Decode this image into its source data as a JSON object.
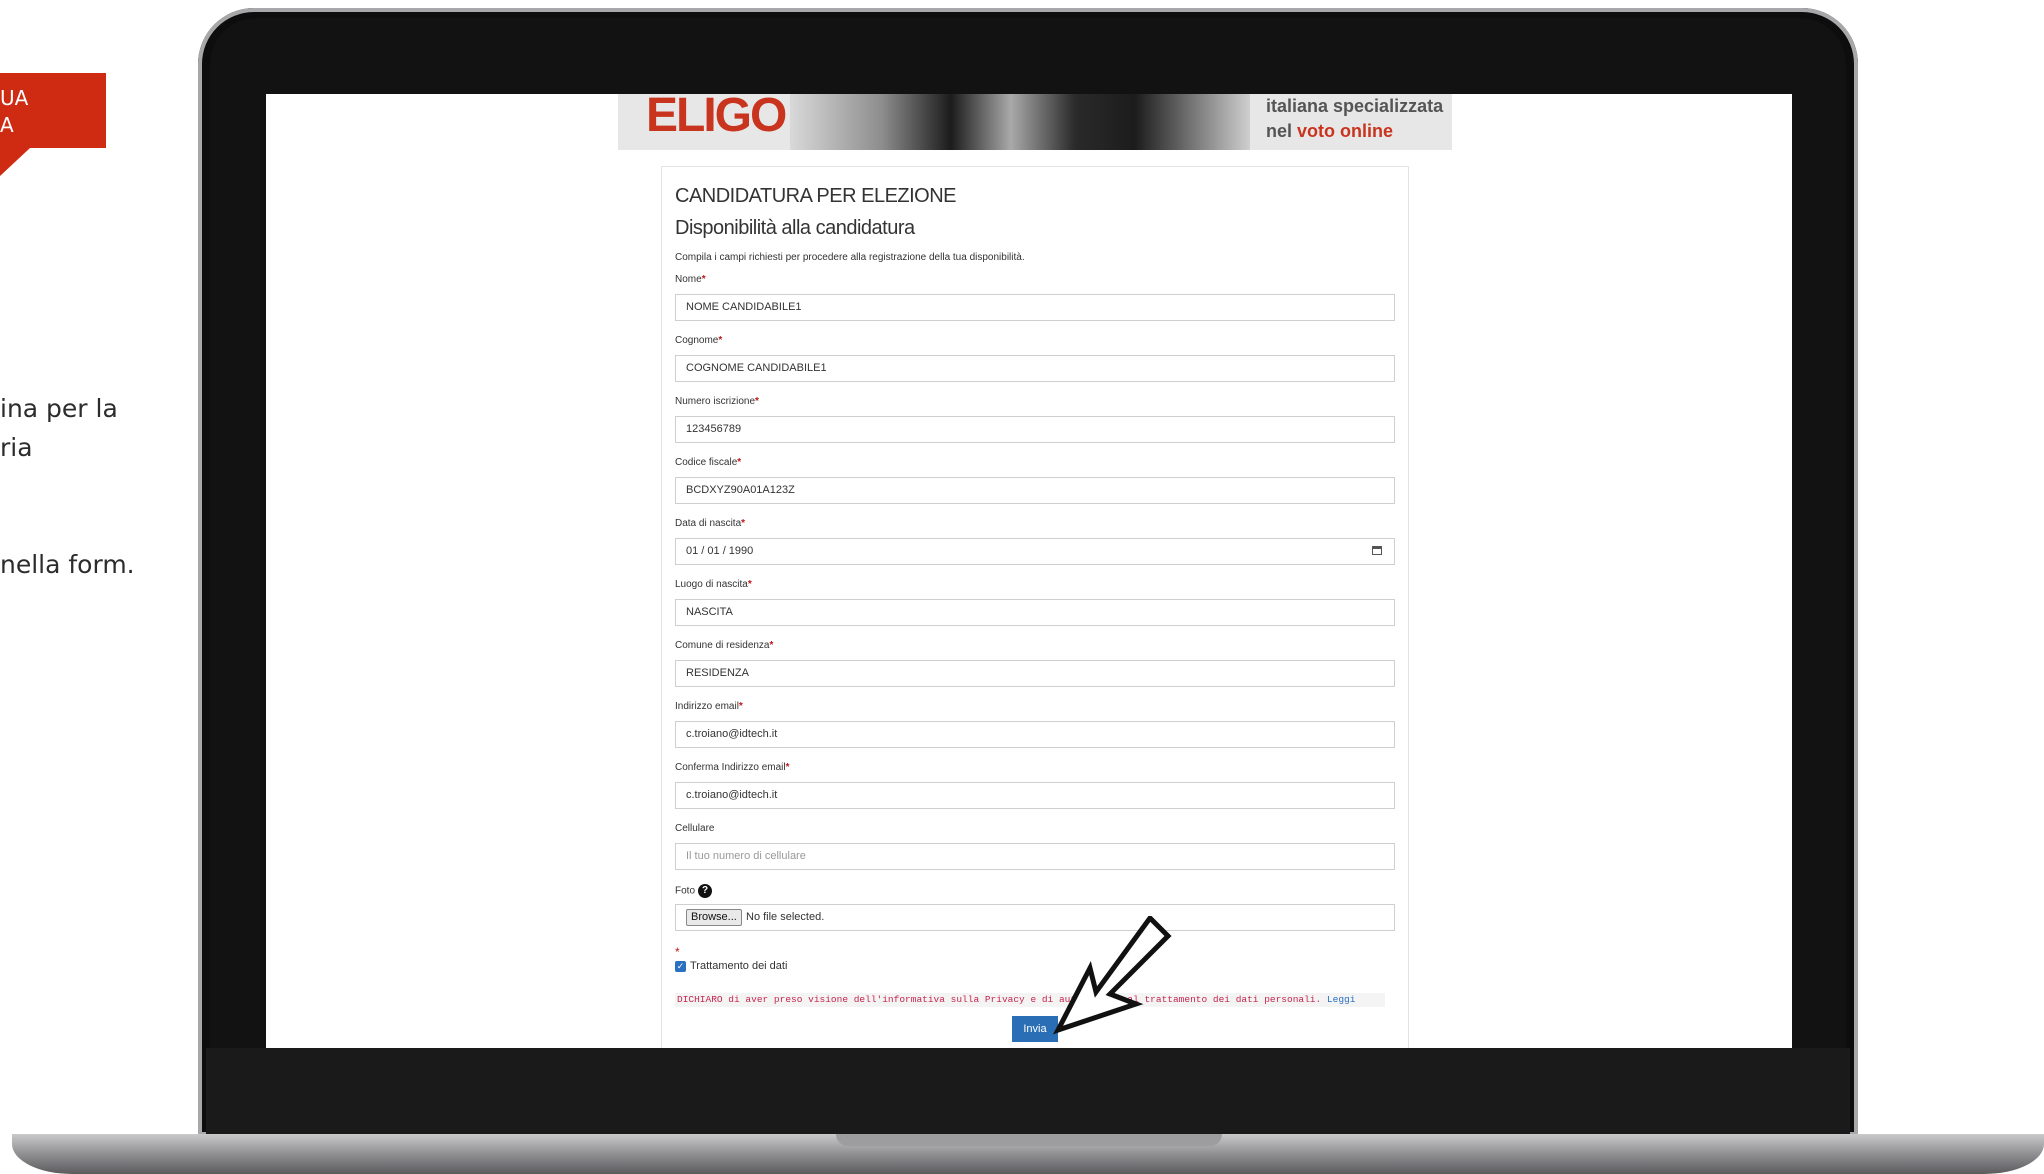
{
  "left_panel": {
    "tag_line1": "UA",
    "tag_line2": "A",
    "text_line1": "ina per la",
    "text_line2": "ria",
    "text_line3": "nella form."
  },
  "banner": {
    "logo": "ELIGO",
    "tagline_line1": "italiana specializzata",
    "tagline_line2_prefix": "nel",
    "tagline_line2_highlight": "voto online"
  },
  "form": {
    "title": "CANDIDATURA PER ELEZIONE",
    "subtitle": "Disponibilità alla candidatura",
    "intro": "Compila i campi richiesti per procedere alla registrazione della tua disponibilità.",
    "required_mark": "*",
    "fields": {
      "nome": {
        "label": "Nome",
        "value": "NOME CANDIDABILE1"
      },
      "cognome": {
        "label": "Cognome",
        "value": "COGNOME CANDIDABILE1"
      },
      "numero": {
        "label": "Numero iscrizione",
        "value": "123456789"
      },
      "codice": {
        "label": "Codice fiscale",
        "value": "BCDXYZ90A01A123Z"
      },
      "data": {
        "label": "Data di nascita",
        "value": "01 / 01 / 1990"
      },
      "luogo": {
        "label": "Luogo di nascita",
        "value": "NASCITA"
      },
      "comune": {
        "label": "Comune di residenza",
        "value": "RESIDENZA"
      },
      "email": {
        "label": "Indirizzo email",
        "value": "c.troiano@idtech.it"
      },
      "conferma": {
        "label": "Conferma Indirizzo email",
        "value": "c.troiano@idtech.it"
      },
      "cellulare": {
        "label": "Cellulare",
        "placeholder": "Il tuo numero di cellulare"
      },
      "foto": {
        "label": "Foto",
        "help": "?",
        "browse": "Browse...",
        "no_file": "No file selected."
      }
    },
    "consent": {
      "checkbox_label": "Trattamento dei dati",
      "checked": true,
      "privacy_text": "DICHIARO di aver preso visione dell'informativa sulla Privacy e di autorizzare al trattamento dei dati personali.",
      "link": "Leggi"
    },
    "submit": "Invia"
  },
  "colors": {
    "accent": "#cf2a12",
    "button": "#2a6fb6",
    "required": "#c01818"
  }
}
